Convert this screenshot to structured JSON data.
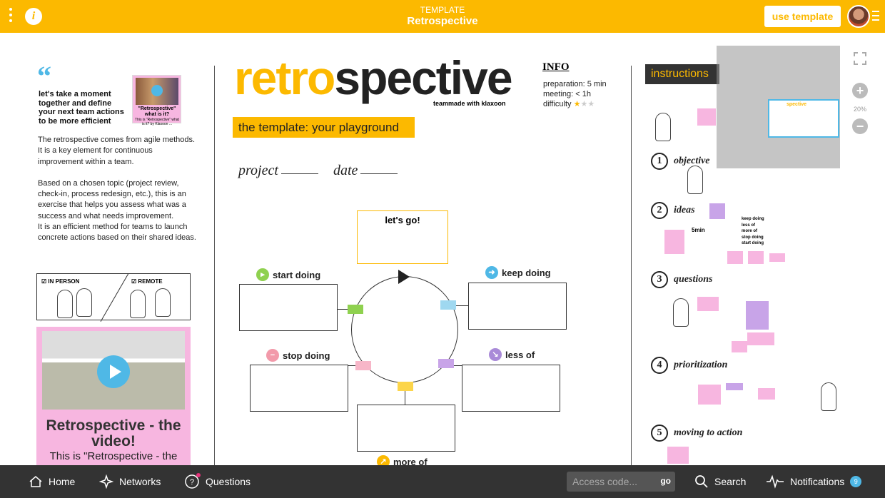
{
  "topbar": {
    "subtitle": "TEMPLATE",
    "title": "Retrospective",
    "use_template_label": "use template",
    "info_label": "i"
  },
  "left": {
    "quote_mark": "“",
    "quote_text": "let's take a moment together and define your next team actions to be more efficient",
    "thumb_title": "\"Retrospective\" what is it?",
    "thumb_sub": "This is \"Retrospective\" what is it? by Klaxoon ...",
    "paragraph1": "The retrospective comes from agile methods. It is a key element for continuous improvement within a team.",
    "paragraph2": "Based on a chosen topic (project review, check-in, process redesign, etc.), this is an exercise that helps you assess what was a success and what needs improvement.",
    "paragraph3": "It is an efficient method for teams to launch concrete actions based on their shared ideas.",
    "in_person_label": "IN PERSON",
    "remote_label": "REMOTE",
    "video_title": "Retrospective - the video!",
    "video_sub": "This is \"Retrospective - the"
  },
  "center": {
    "title_part1": "retro",
    "title_part2": "spective",
    "made_with": "teammade with klaxoon",
    "info_title": "INFO",
    "preparation": "preparation: 5 min",
    "meeting": "meeting: < 1h",
    "difficulty": "difficulty",
    "difficulty_stars": 1,
    "template_banner": "the template: your playground",
    "project_label": "project",
    "date_label": "date",
    "lets_go": "let's go!",
    "start_doing": "start doing",
    "keep_doing": "keep doing",
    "stop_doing": "stop doing",
    "less_of": "less of",
    "more_of": "more of"
  },
  "right": {
    "instructions": "instructions",
    "steps": [
      "objective",
      "ideas",
      "questions",
      "prioritization",
      "moving to action"
    ],
    "step_numbers": [
      "1",
      "2",
      "3",
      "4",
      "5"
    ],
    "keep_list": [
      "keep doing",
      "less of",
      "more of",
      "stop doing",
      "start doing"
    ],
    "five_min": "5min"
  },
  "zoom": {
    "level": "20%",
    "plus": "+",
    "minus": "−"
  },
  "bottombar": {
    "home": "Home",
    "networks": "Networks",
    "questions": "Questions",
    "access_placeholder": "Access code...",
    "go": "go",
    "search": "Search",
    "notifications": "Notifications",
    "notification_count": "9"
  },
  "colors": {
    "brand_yellow": "#fcb900",
    "accent_blue": "#4fb8e6",
    "sticky_pink": "#f7b6e0",
    "sticky_purple": "#c8a4e8",
    "bar_dark": "#333333"
  }
}
